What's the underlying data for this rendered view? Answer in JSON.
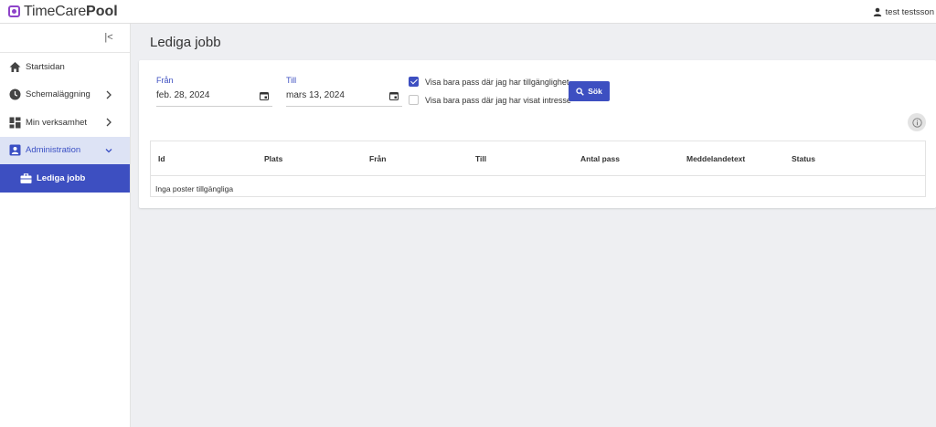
{
  "brand": {
    "name_light": "TimeCare",
    "name_bold": "Pool",
    "color": "#8e44c9"
  },
  "user": {
    "name": "test testsson",
    "icon": "person-icon"
  },
  "accent": "#3d4fc1",
  "sidebar": {
    "collapse_icon": "collapse-left-icon",
    "items": [
      {
        "label": "Startsidan",
        "icon": "home-icon"
      },
      {
        "label": "Schemaläggning",
        "icon": "clock-icon",
        "has_children": true
      },
      {
        "label": "Min verksamhet",
        "icon": "dashboard-icon",
        "has_children": true
      },
      {
        "label": "Administration",
        "icon": "badge-icon",
        "expanded": true
      },
      {
        "label": "Lediga jobb",
        "icon": "briefcase-icon",
        "selected": true
      }
    ]
  },
  "page": {
    "title": "Lediga jobb"
  },
  "filters": {
    "from": {
      "label": "Från",
      "value": "feb. 28, 2024"
    },
    "to": {
      "label": "Till",
      "value": "mars 13, 2024"
    },
    "checkbox_available": {
      "label": "Visa bara pass där jag har tillgänglighet",
      "checked": true
    },
    "checkbox_interest": {
      "label": "Visa bara pass där jag har visat intresse",
      "checked": false
    },
    "search_label": "Sök"
  },
  "table": {
    "columns": [
      "Id",
      "Plats",
      "Från",
      "Till",
      "Antal pass",
      "Meddelandetext",
      "Status"
    ],
    "empty_text": "Inga poster tillgängliga"
  }
}
